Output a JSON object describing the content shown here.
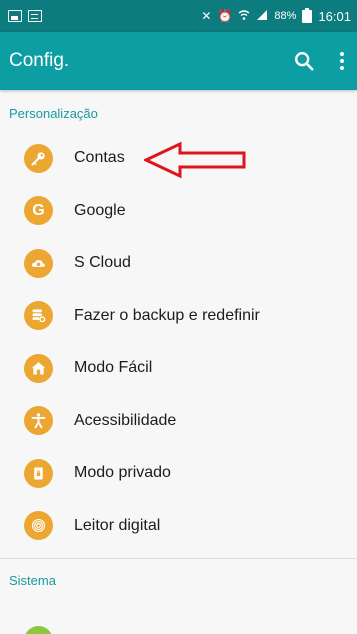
{
  "status_bar": {
    "battery_percent": "88%",
    "time": "16:01"
  },
  "app_bar": {
    "title": "Config."
  },
  "sections": {
    "personalizacao": "Personalização",
    "sistema": "Sistema"
  },
  "items": [
    {
      "label": "Contas",
      "icon": "key-icon"
    },
    {
      "label": "Google",
      "icon": "google-icon"
    },
    {
      "label": "S Cloud",
      "icon": "cloud-sync-icon"
    },
    {
      "label": "Fazer o backup e redefinir",
      "icon": "backup-icon"
    },
    {
      "label": "Modo Fácil",
      "icon": "easy-mode-icon"
    },
    {
      "label": "Acessibilidade",
      "icon": "accessibility-icon"
    },
    {
      "label": "Modo privado",
      "icon": "private-mode-icon"
    },
    {
      "label": "Leitor digital",
      "icon": "fingerprint-icon"
    }
  ],
  "colors": {
    "status_bar": "#0d7c7e",
    "app_bar": "#0c9ea3",
    "section_header": "#1a9aa0",
    "icon_orange": "#eca733",
    "arrow_red": "#e0151b"
  }
}
